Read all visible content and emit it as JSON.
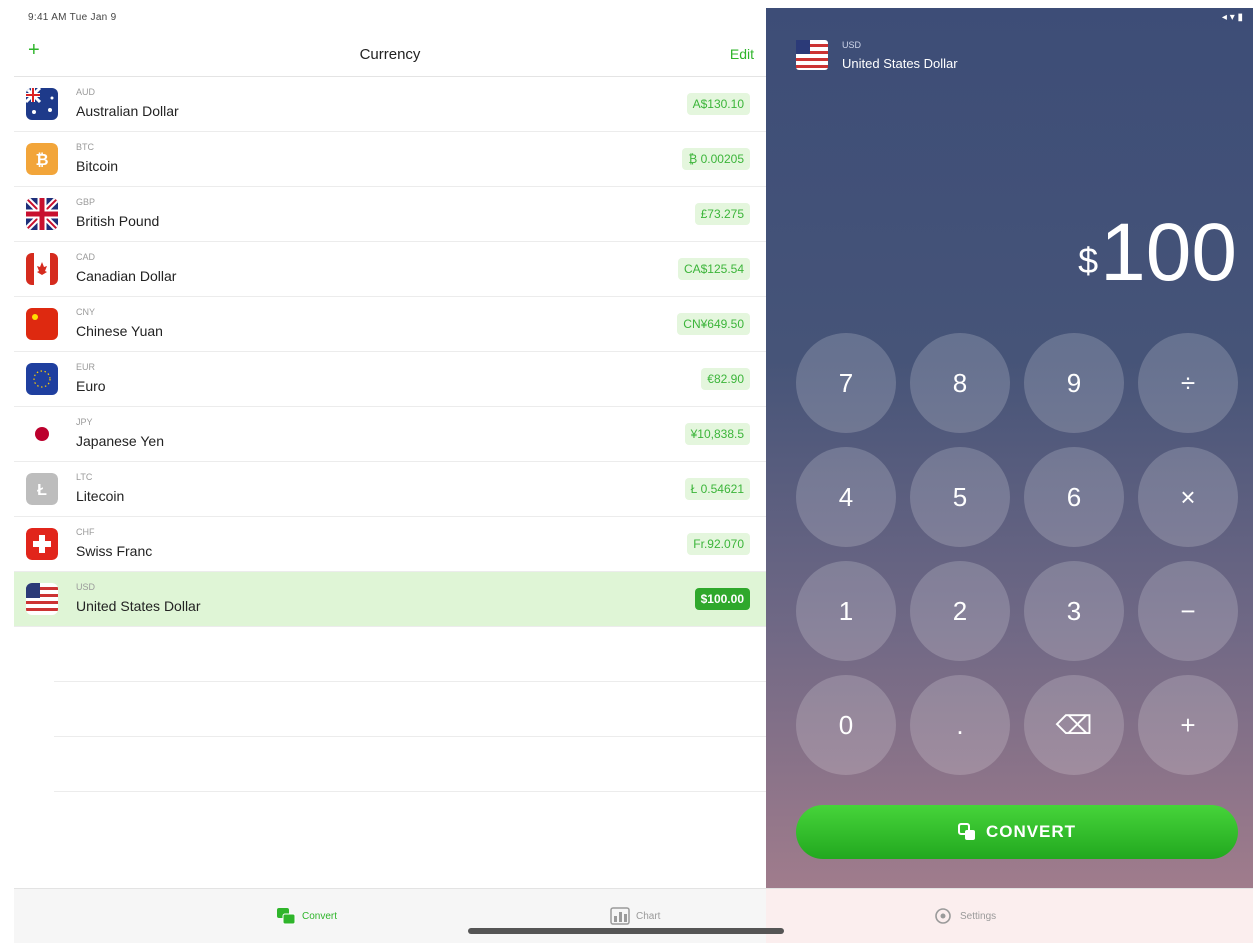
{
  "status_bar": {
    "time": "9:41 AM  Tue Jan 9",
    "right_icons": "◂ ▾ ▮"
  },
  "nav": {
    "add_label": "+",
    "title": "Currency",
    "edit_label": "Edit"
  },
  "currencies": [
    {
      "code": "AUD",
      "name": "Australian Dollar",
      "amount": "A$130.10",
      "flag": "au"
    },
    {
      "code": "BTC",
      "name": "Bitcoin",
      "amount": "₿ 0.00205",
      "flag": "btc"
    },
    {
      "code": "GBP",
      "name": "British Pound",
      "amount": "£73.275",
      "flag": "gb"
    },
    {
      "code": "CAD",
      "name": "Canadian Dollar",
      "amount": "CA$125.54",
      "flag": "ca"
    },
    {
      "code": "CNY",
      "name": "Chinese Yuan",
      "amount": "CN¥649.50",
      "flag": "cn"
    },
    {
      "code": "EUR",
      "name": "Euro",
      "amount": "€82.90",
      "flag": "eu"
    },
    {
      "code": "JPY",
      "name": "Japanese Yen",
      "amount": "¥10,838.5",
      "flag": "jp"
    },
    {
      "code": "LTC",
      "name": "Litecoin",
      "amount": "Ł 0.54621",
      "flag": "ltc"
    },
    {
      "code": "CHF",
      "name": "Swiss Franc",
      "amount": "Fr.92.070",
      "flag": "ch"
    },
    {
      "code": "USD",
      "name": "United States Dollar",
      "amount": "$100.00",
      "flag": "us",
      "selected": true
    }
  ],
  "selected": {
    "code": "USD",
    "name": "United States Dollar"
  },
  "display": {
    "currency_symbol": "$",
    "value": "100"
  },
  "keypad": [
    "7",
    "8",
    "9",
    "÷",
    "4",
    "5",
    "6",
    "×",
    "1",
    "2",
    "3",
    "−",
    "0",
    ".",
    "⌫",
    "+"
  ],
  "convert_button": {
    "label": "CONVERT"
  },
  "tabs": [
    {
      "label": "Convert",
      "icon": "currency-exchange-icon",
      "active": true
    },
    {
      "label": "Chart",
      "icon": "chart-icon",
      "active": false
    },
    {
      "label": "Settings",
      "icon": "settings-icon",
      "active": false
    }
  ],
  "colors": {
    "accent": "#2fb52b",
    "panel_top": "#3d4d77",
    "panel_bottom": "#a07c8c"
  }
}
